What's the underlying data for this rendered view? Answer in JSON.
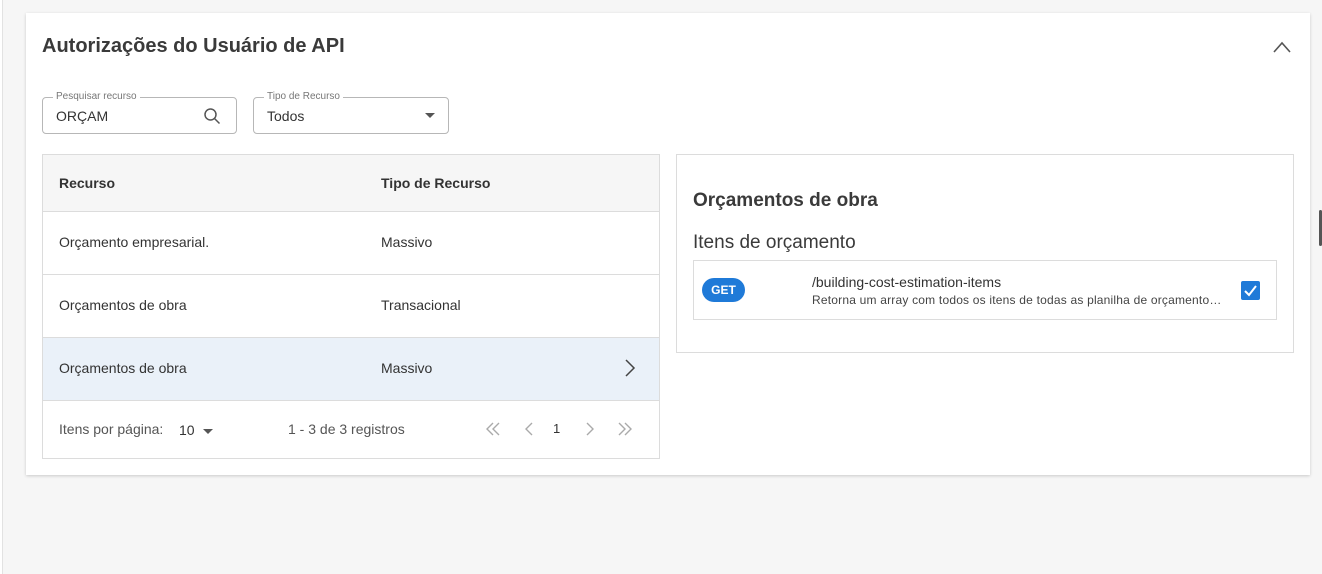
{
  "card": {
    "title": "Autorizações do Usuário de API"
  },
  "filters": {
    "search": {
      "label": "Pesquisar recurso",
      "value": "ORÇAM"
    },
    "resource_type": {
      "label": "Tipo de Recurso",
      "value": "Todos"
    }
  },
  "table": {
    "columns": [
      "Recurso",
      "Tipo de Recurso"
    ],
    "rows": [
      {
        "resource": "Orçamento empresarial.",
        "type": "Massivo"
      },
      {
        "resource": "Orçamentos de obra",
        "type": "Transacional"
      },
      {
        "resource": "Orçamentos de obra",
        "type": "Massivo",
        "selected": true
      }
    ],
    "footer": {
      "per_page_label": "Itens por página:",
      "per_page_value": "10",
      "range": "1 - 3 de 3 registros",
      "current_page": "1"
    }
  },
  "detail": {
    "title": "Orçamentos de obra",
    "subtitle": "Itens de orçamento",
    "endpoint": {
      "method": "GET",
      "path": "/building-cost-estimation-items",
      "description": "Retorna um array com todos os itens de todas as planilha de orçamentos de obra",
      "checked": true
    }
  },
  "colors": {
    "accent": "#1f7ad8",
    "selected_row": "#eaf1f9",
    "header_bg": "#f6f6f6"
  }
}
